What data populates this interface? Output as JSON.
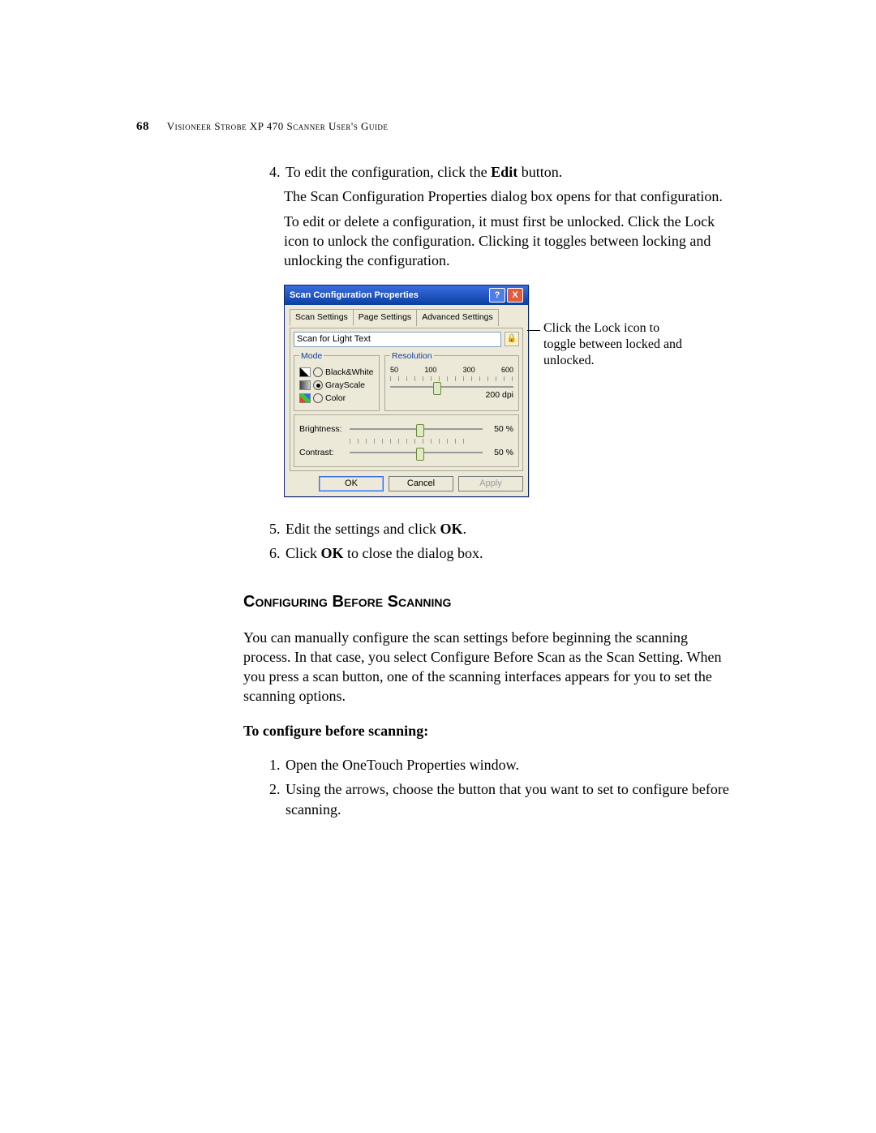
{
  "page_number": "68",
  "header_text": "Visioneer Strobe XP 470 Scanner User's Guide",
  "step4": {
    "num": "4.",
    "text_a": "To edit the configuration, click the ",
    "text_bold": "Edit",
    "text_b": " button.",
    "para1": "The Scan Configuration Properties dialog box opens for that configuration.",
    "para2": "To edit or delete a configuration, it must first be unlocked. Click the Lock icon to unlock the configuration. Clicking it toggles between locking and unlocking the configuration."
  },
  "dialog": {
    "title": "Scan Configuration Properties",
    "help": "?",
    "close": "X",
    "tabs": [
      "Scan Settings",
      "Page Settings",
      "Advanced Settings"
    ],
    "config_name": "Scan for Light Text",
    "lock_glyph": "🔒",
    "groups": {
      "mode": "Mode",
      "resolution": "Resolution"
    },
    "modes": {
      "bw": "Black&White",
      "gs": "GrayScale",
      "cl": "Color"
    },
    "resolution": {
      "ticks": [
        "50",
        "100",
        "300",
        "600"
      ],
      "value": "200 dpi",
      "thumb_pct": 35
    },
    "brightness": {
      "label": "Brightness:",
      "value": "50 %",
      "thumb_pct": 50
    },
    "contrast": {
      "label": "Contrast:",
      "value": "50 %",
      "thumb_pct": 50
    },
    "buttons": {
      "ok": "OK",
      "cancel": "Cancel",
      "apply": "Apply"
    }
  },
  "callout": "Click the Lock icon to toggle between locked and unlocked.",
  "step5": {
    "text_a": "Edit the settings and click ",
    "bold": "OK",
    "text_b": "."
  },
  "step6": {
    "text_a": "Click ",
    "bold": "OK",
    "text_b": " to close the dialog box."
  },
  "heading": "Configuring Before Scanning",
  "intro": "You can manually configure the scan settings before beginning the scanning process. In that case, you select Configure Before Scan as the Scan Setting. When you press a scan button, one of the scanning interfaces appears for you to set the scanning options.",
  "subheading": "To configure before scanning:",
  "bstep1": "Open the OneTouch Properties window.",
  "bstep2": "Using the arrows, choose the button that you want to set to configure before scanning."
}
